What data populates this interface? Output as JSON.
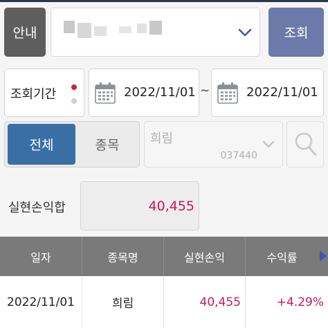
{
  "header": {
    "notice_label": "안내",
    "search_label": "조회"
  },
  "period": {
    "label": "조회기간",
    "start_date": "2022/11/01",
    "separator": "~",
    "end_date": "2022/11/01"
  },
  "filter": {
    "all_label": "전체",
    "item_label": "종목",
    "stock_name": "희림",
    "stock_code": "037440"
  },
  "summary": {
    "label": "실현손익합",
    "value": "40,455"
  },
  "table": {
    "columns": [
      "일자",
      "종목명",
      "실현손익",
      "수익률"
    ],
    "rows": [
      {
        "date": "2022/11/01",
        "name": "희림",
        "profit": "40,455",
        "rate": "+4.29%"
      }
    ]
  },
  "colors": {
    "accent_blue": "#3a6fa6",
    "search_button": "#6b7aa8",
    "profit_pink": "#c8175d"
  }
}
